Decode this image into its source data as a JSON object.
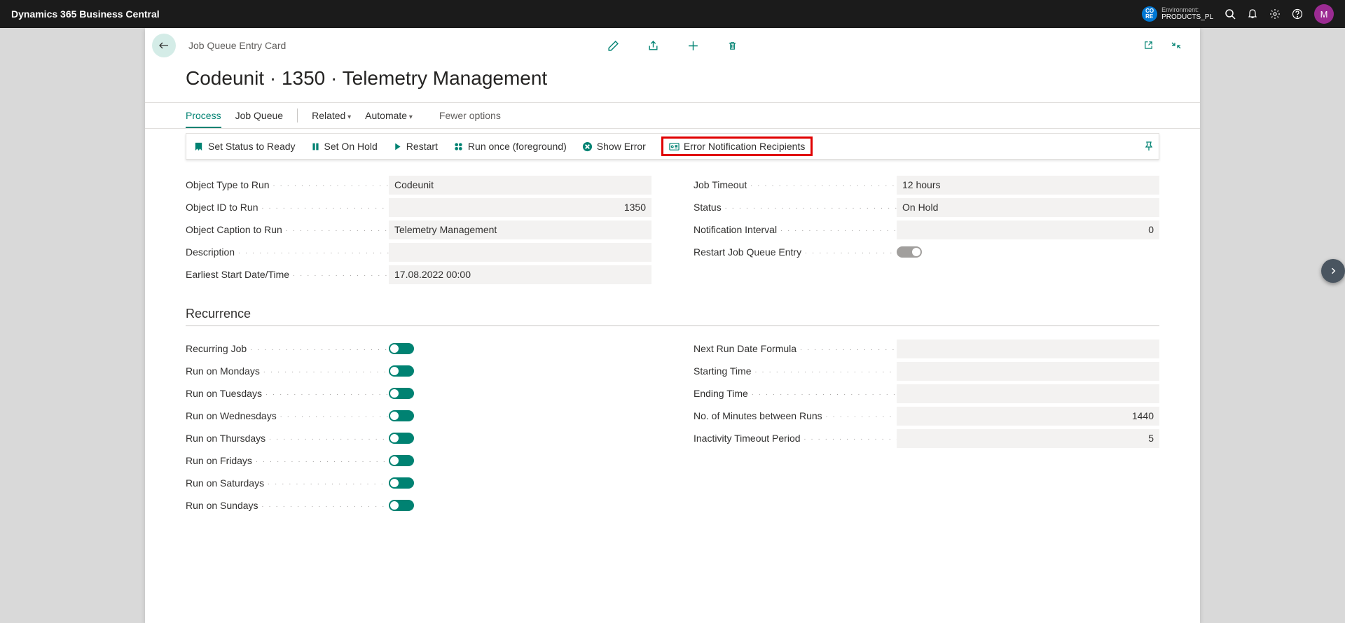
{
  "topbar": {
    "title": "Dynamics 365 Business Central",
    "env_badge": "CO RE",
    "env_label": "Environment:",
    "env_value": "PRODUCTS_PL",
    "avatar_letter": "M"
  },
  "header": {
    "page_name": "Job Queue Entry Card",
    "page_title": "Codeunit · 1350 · Telemetry Management"
  },
  "menubar": {
    "process": "Process",
    "job_queue": "Job Queue",
    "related": "Related",
    "automate": "Automate",
    "fewer": "Fewer options"
  },
  "actions": {
    "set_ready": "Set Status to Ready",
    "set_hold": "Set On Hold",
    "restart": "Restart",
    "run_once": "Run once (foreground)",
    "show_error": "Show Error",
    "error_notif": "Error Notification Recipients"
  },
  "fields_left": {
    "object_type_label": "Object Type to Run",
    "object_type_value": "Codeunit",
    "object_id_label": "Object ID to Run",
    "object_id_value": "1350",
    "object_caption_label": "Object Caption to Run",
    "object_caption_value": "Telemetry Management",
    "description_label": "Description",
    "description_value": "",
    "earliest_label": "Earliest Start Date/Time",
    "earliest_value": "17.08.2022 00:00"
  },
  "fields_right": {
    "timeout_label": "Job Timeout",
    "timeout_value": "12 hours",
    "status_label": "Status",
    "status_value": "On Hold",
    "notif_interval_label": "Notification Interval",
    "notif_interval_value": "0",
    "restart_label": "Restart Job Queue Entry"
  },
  "recurrence": {
    "title": "Recurrence",
    "recurring_label": "Recurring Job",
    "mon_label": "Run on Mondays",
    "tue_label": "Run on Tuesdays",
    "wed_label": "Run on Wednesdays",
    "thu_label": "Run on Thursdays",
    "fri_label": "Run on Fridays",
    "sat_label": "Run on Saturdays",
    "sun_label": "Run on Sundays",
    "next_run_label": "Next Run Date Formula",
    "next_run_value": "",
    "starting_label": "Starting Time",
    "starting_value": "",
    "ending_label": "Ending Time",
    "ending_value": "",
    "minutes_label": "No. of Minutes between Runs",
    "minutes_value": "1440",
    "inactivity_label": "Inactivity Timeout Period",
    "inactivity_value": "5"
  }
}
